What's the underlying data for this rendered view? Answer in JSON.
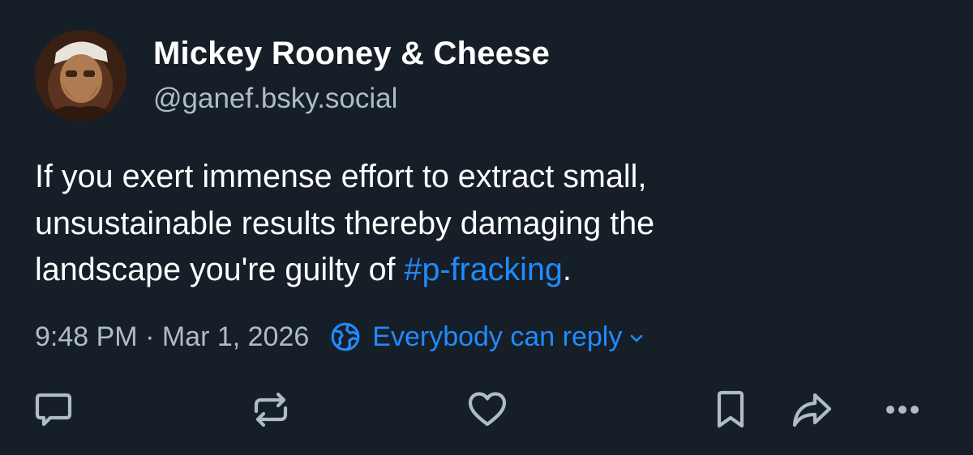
{
  "author": {
    "display_name": "Mickey Rooney & Cheese",
    "handle": "@ganef.bsky.social",
    "avatar_icon": "avatar-photo"
  },
  "post": {
    "lines": [
      "If you exert immense effort to extract small,",
      "unsustainable results thereby damaging the",
      "landscape you're guilty of "
    ],
    "hashtag": "#p-fracking",
    "trailing": "."
  },
  "meta": {
    "timestamp": "9:48 PM · Mar 1, 2026",
    "reply_setting": "Everybody can reply"
  },
  "actions": [
    {
      "name": "reply",
      "icon": "speech-bubble-icon"
    },
    {
      "name": "repost",
      "icon": "repost-icon"
    },
    {
      "name": "like",
      "icon": "heart-icon"
    },
    {
      "name": "bookmark",
      "icon": "bookmark-icon"
    },
    {
      "name": "share",
      "icon": "share-arrow-icon"
    },
    {
      "name": "more",
      "icon": "more-dots-icon"
    }
  ],
  "colors": {
    "background": "#161e27",
    "text": "#ffffff",
    "secondary_text": "#aebbc9",
    "link": "#208bfe",
    "icon": "#aebbc9"
  }
}
